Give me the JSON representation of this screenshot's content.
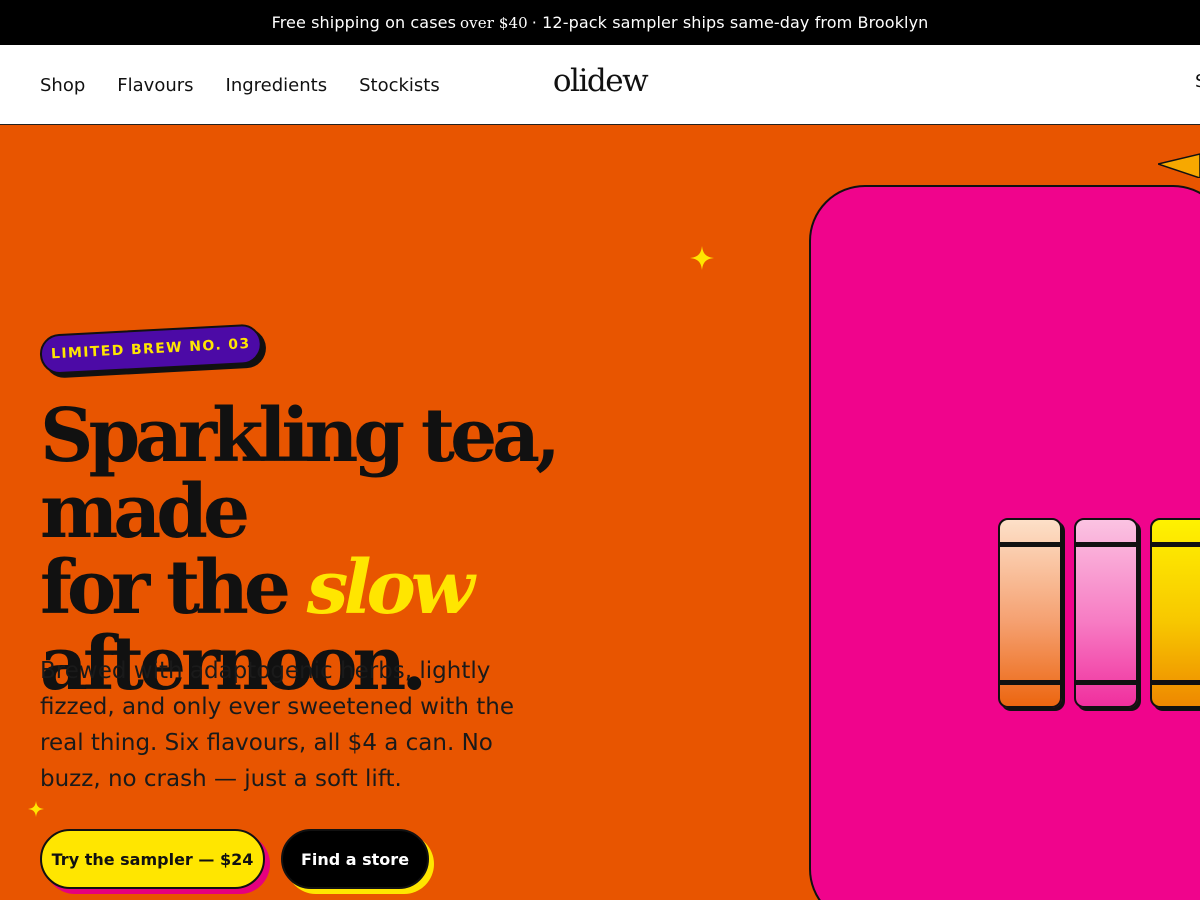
{
  "announcement": {
    "part1": "Free shipping on cases",
    "part2": "over $40",
    "part3": "· 12-pack sampler ships same-day from Brooklyn"
  },
  "nav": {
    "links": [
      "Shop",
      "Flavours",
      "Ingredients",
      "Stockists"
    ],
    "logo": "olidew",
    "right_partial": "S"
  },
  "hero": {
    "badge": "LIMITED BREW NO. 03",
    "headline": {
      "line1": "Sparkling tea, made",
      "line2_pre": "for the",
      "line2_accent": "slow",
      "line3": "afternoon."
    },
    "subcopy": "Brewed with adaptogenic herbs, lightly fizzed, and only ever sweetened with the real thing. Six flavours, all $4 a can. No buzz, no crash — just a soft lift.",
    "cta_primary": "Try the sampler — $24",
    "cta_secondary": "Find a store"
  },
  "product_visual": {
    "cans": [
      {
        "name": "peach-can",
        "color": "#f5a070"
      },
      {
        "name": "pink-can",
        "color": "#f77bc3"
      },
      {
        "name": "yellow-can",
        "color": "#f7c700"
      }
    ]
  },
  "colors": {
    "hero_bg": "#e85500",
    "panel_pink": "#f0048c",
    "accent_yellow": "#ffe600",
    "badge_purple": "#4c0aa6",
    "ink": "#111111"
  },
  "icons": [
    "sparkle-icon",
    "sparkle-icon-small",
    "triangle-decoration-icon"
  ]
}
